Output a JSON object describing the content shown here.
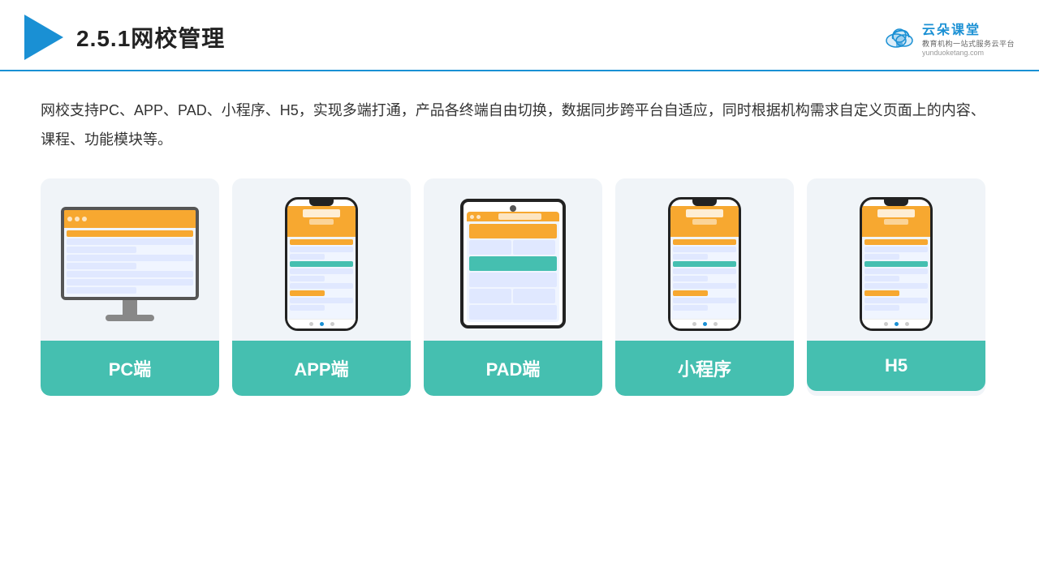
{
  "header": {
    "title": "2.5.1网校管理",
    "brand": {
      "name": "云朵课堂",
      "tagline": "教育机构一站式服务云平台",
      "url": "yunduoketang.com"
    }
  },
  "content": {
    "description": "网校支持PC、APP、PAD、小程序、H5，实现多端打通，产品各终端自由切换，数据同步跨平台自适应，同时根据机构需求自定义页面上的内容、课程、功能模块等。"
  },
  "cards": [
    {
      "id": "pc",
      "label": "PC端"
    },
    {
      "id": "app",
      "label": "APP端"
    },
    {
      "id": "pad",
      "label": "PAD端"
    },
    {
      "id": "miniprogram",
      "label": "小程序"
    },
    {
      "id": "h5",
      "label": "H5"
    }
  ],
  "colors": {
    "accent": "#45bfb0",
    "blue": "#1a90d4",
    "text": "#333"
  }
}
